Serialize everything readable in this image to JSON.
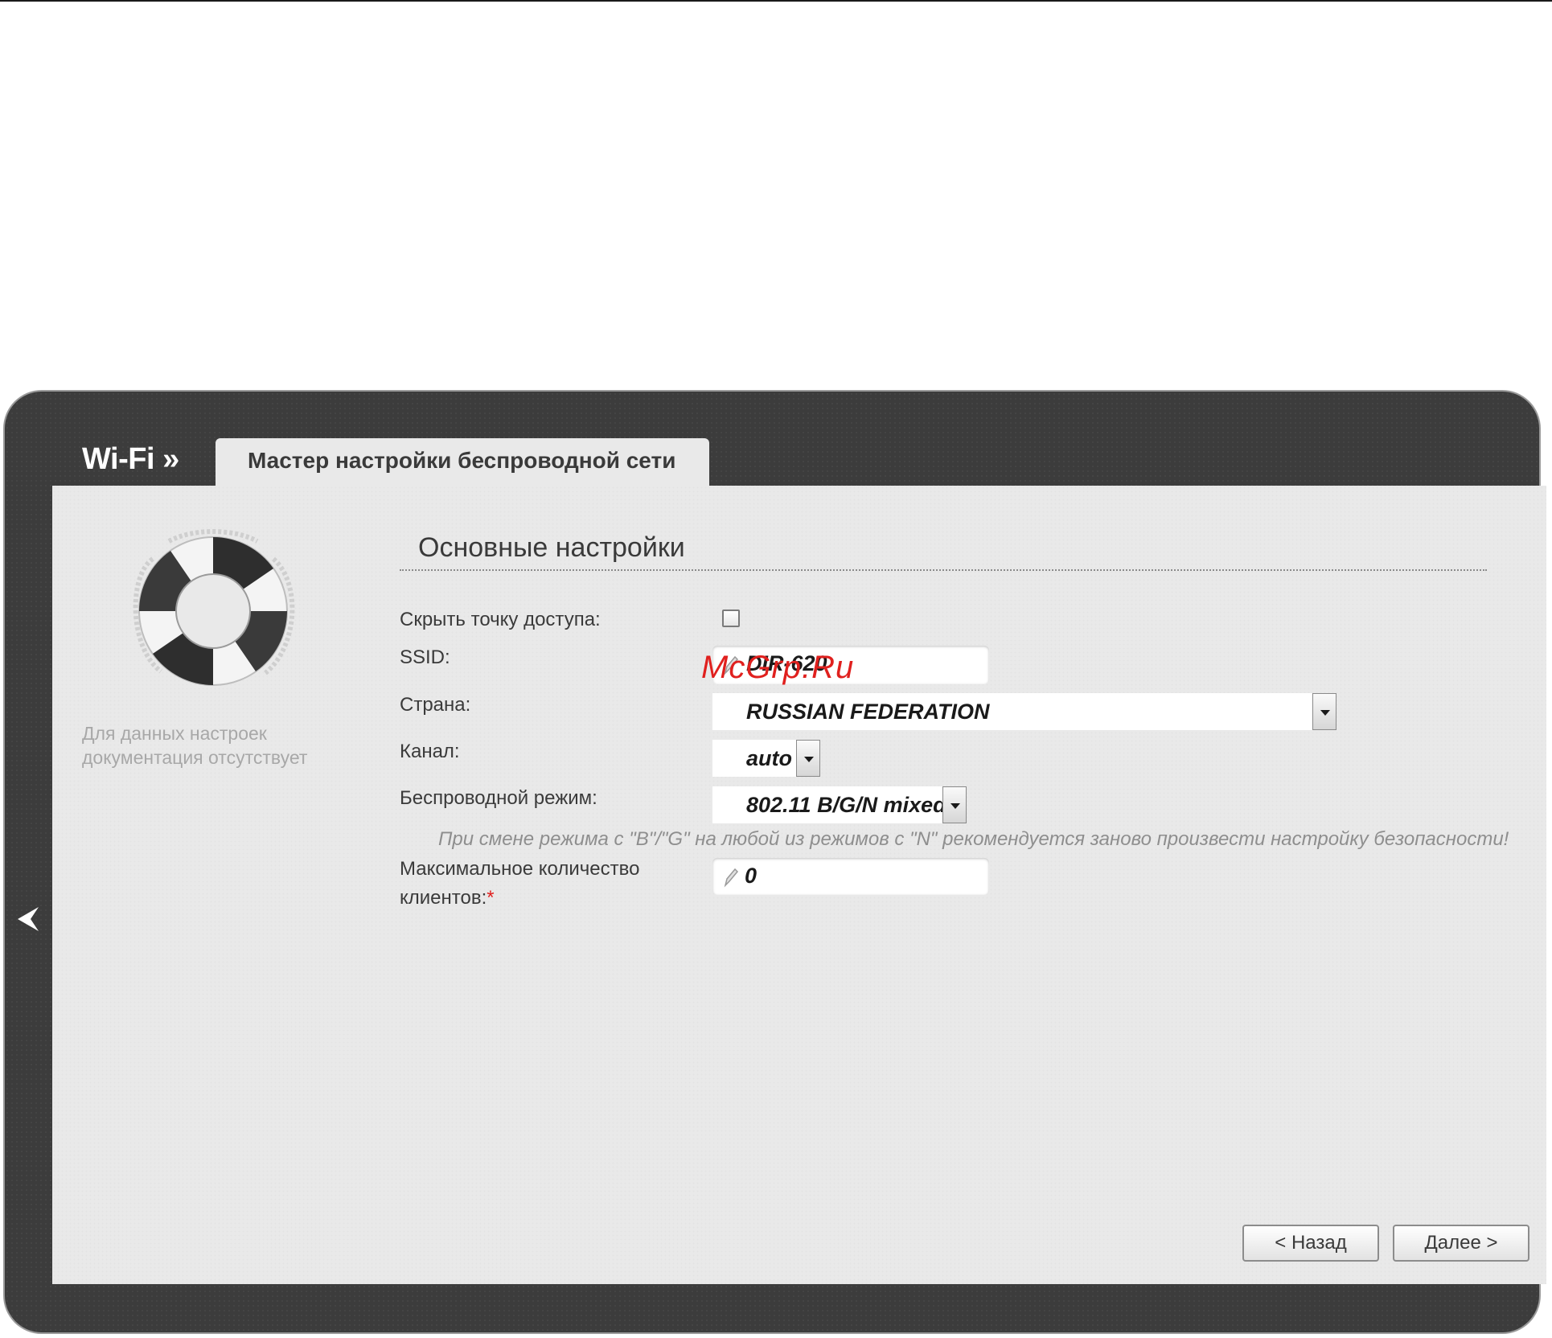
{
  "header": {
    "section": "Wi-Fi »",
    "tab": "Мастер настройки беспроводной сети"
  },
  "sidebar": {
    "help_text": "Для данных настроек документация отсутствует",
    "icon": "lifebuoy-icon"
  },
  "form": {
    "title": "Основные настройки",
    "hide_ap_label": "Скрыть точку доступа:",
    "hide_ap_checked": false,
    "ssid_label": "SSID:",
    "ssid_value": "DIR-620",
    "country_label": "Страна:",
    "country_value": "RUSSIAN FEDERATION",
    "channel_label": "Канал:",
    "channel_value": "auto",
    "mode_label": "Беспроводной режим:",
    "mode_value": "802.11 B/G/N mixed",
    "mode_note": "При смене режима с \"B\"/\"G\" на любой из режимов с \"N\" рекомендуется заново произвести настройку безопасности!",
    "max_clients_label_line1": "Максимальное количество",
    "max_clients_label_line2": "клиентов:",
    "required_mark": "*",
    "max_clients_value": "0"
  },
  "buttons": {
    "back": "< Назад",
    "next": "Далее >"
  },
  "watermark": "McGrp.Ru",
  "colors": {
    "frame": "#3c3c3c",
    "panel": "#e9e9e9",
    "required": "#e0201e"
  }
}
